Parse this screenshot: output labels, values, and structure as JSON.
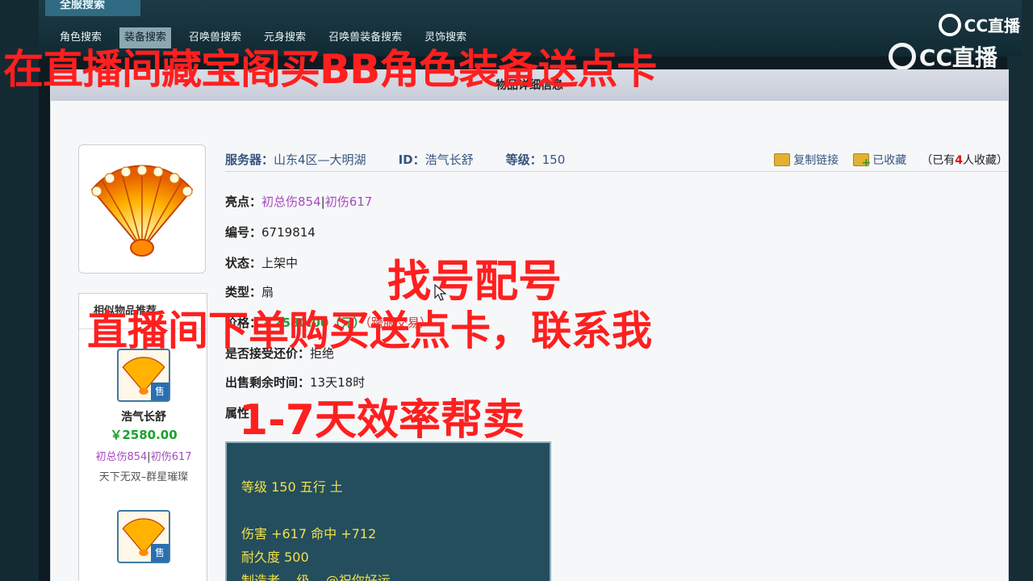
{
  "top": {
    "tab": "全服搜索",
    "nav": [
      "角色搜索",
      "装备搜索",
      "召唤兽搜索",
      "元身搜索",
      "召唤兽装备搜索",
      "灵饰搜索"
    ],
    "active_index": 1
  },
  "watermark": {
    "brand": "CC直播"
  },
  "overlay": {
    "top": "在直播间藏宝阁买BB角色装备送点卡",
    "mid1": "找号配号",
    "mid2": "直播间下单购买送点卡，联系我",
    "mid3": "1-7天效率帮卖"
  },
  "panel": {
    "title": "物品详细信息"
  },
  "info": {
    "server_label": "服务器：",
    "server_value": "山东4区—大明湖",
    "id_label": "ID：",
    "id_value": "浩气长舒",
    "level_label": "等级：",
    "level_value": "150",
    "copy_link": "复制链接",
    "favorited": "已收藏",
    "fav_prefix": "（已有",
    "fav_num": "4",
    "fav_suffix": "人收藏）"
  },
  "fields": {
    "highlight_label": "亮点：",
    "highlight_1": "初总伤854",
    "highlight_sep": "|",
    "highlight_2": "初伤617",
    "serial_label": "编号：",
    "serial_value": "6719814",
    "status_label": "状态：",
    "status_value": "上架中",
    "type_label": "类型：",
    "type_value": "扇",
    "price_label": "价格：",
    "price_value": "￥2580.00（元）",
    "price_cross": "（跨服交易）",
    "bargain_label": "是否接受还价：",
    "bargain_value": "拒绝",
    "remain_label": "出售剩余时间：",
    "remain_value": "13天18时",
    "attr_label": "属性："
  },
  "attributes": {
    "line1": "等级 150 五行 土",
    "line2": "伤害 +617 命中 +712",
    "line3": "耐久度 500",
    "line4": "制造者 ...级 ...@祝你好运"
  },
  "recommend": {
    "title": "相似物品推荐",
    "items": [
      {
        "name": "浩气长舒",
        "price": "￥2580.00",
        "tag1": "初总伤854",
        "tag_sep": "|",
        "tag2": "初伤617",
        "desc": "天下无双–群星璀璨",
        "sold": "售"
      },
      {
        "sold": "售"
      }
    ]
  },
  "colors": {
    "overlay": "#ff1f1f",
    "link": "#35557f",
    "highlight": "#a64bbf",
    "price": "#16a32c",
    "attr_text": "#f2e04a"
  },
  "icons": [
    "fan-icon",
    "copy-link-icon",
    "favorite-icon",
    "cursor-icon",
    "cc-live-logo-icon"
  ]
}
